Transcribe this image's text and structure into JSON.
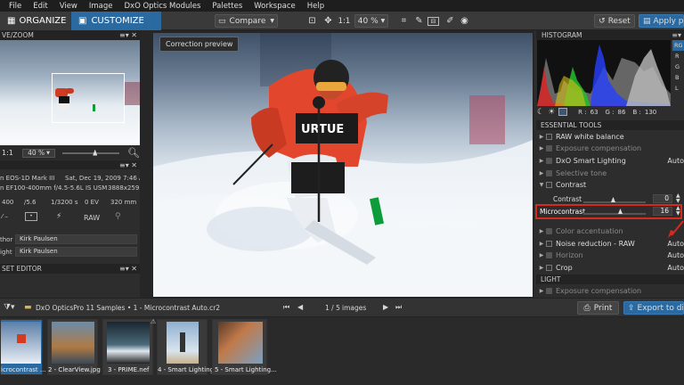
{
  "menu": [
    "File",
    "Edit",
    "View",
    "Image",
    "DxO Optics Modules",
    "Palettes",
    "Workspace",
    "Help"
  ],
  "tabs": {
    "organize": "ORGANIZE",
    "customize": "CUSTOMIZE"
  },
  "toolbar": {
    "compare": "Compare",
    "ratio": "1:1",
    "zoom": "40 %",
    "reset": "Reset",
    "apply": "Apply pre"
  },
  "left": {
    "nav_header": "VE/ZOOM",
    "zoom_ratio": "1:1",
    "zoom_value": "40 %",
    "camera": "n EOS-1D Mark III",
    "date": "Sat, Dec 19, 2009 7:46 AM",
    "lens": "n EF100-400mm f/4.5-5.6L IS USM",
    "dims": "3888x2592",
    "iso": "400",
    "aperture": "/5.6",
    "shutter": "1/3200 s",
    "ev": "0 EV",
    "focal": "320 mm",
    "raw": "RAW",
    "author_label": "thor",
    "author": "Kirk Paulsen",
    "copyright_label": "ight",
    "copyright": "Kirk Paulsen",
    "preset_header": "SET EDITOR"
  },
  "viewer": {
    "preview_label": "Correction preview"
  },
  "right": {
    "histogram_header": "HISTOGRAM",
    "channels": [
      "RG",
      "R",
      "G",
      "B",
      "L"
    ],
    "rgb_readout": {
      "r_label": "R :",
      "r": "63",
      "g_label": "G :",
      "g": "86",
      "b_label": "B :",
      "b": "130"
    },
    "essential_header": "ESSENTIAL TOOLS",
    "tools": [
      {
        "label": "RAW white balance",
        "value": ""
      },
      {
        "label": "Exposure compensation",
        "value": ""
      },
      {
        "label": "DxO Smart Lighting",
        "value": "Auto"
      },
      {
        "label": "Selective tone",
        "value": ""
      },
      {
        "label": "Contrast",
        "value": ""
      }
    ],
    "contrast_label": "Contrast",
    "contrast_value": "0",
    "microcontrast_label": "Microcontrast",
    "microcontrast_value": "16",
    "tools2": [
      {
        "label": "Color accentuation",
        "value": ""
      },
      {
        "label": "Noise reduction - RAW",
        "value": "Auto"
      },
      {
        "label": "Horizon",
        "value": "Auto"
      },
      {
        "label": "Crop",
        "value": "Auto"
      }
    ],
    "light_header": "LIGHT",
    "light_tool": "Exposure compensation"
  },
  "film": {
    "path": "DxO OpticsPro 11 Samples • 1 - Microcontrast Auto.cr2",
    "counter": "1 / 5",
    "counter_suffix": "images",
    "print": "Print",
    "export": "Export to dis",
    "thumbs": [
      "icrocontrast ...",
      "2 - ClearView.jpg",
      "3 - PRIME.nef",
      "4 - Smart Lighting....",
      "5 - Smart Lighting..."
    ]
  },
  "colors": {
    "accent": "#2a6aa0",
    "highlight_border": "#d9281e"
  }
}
